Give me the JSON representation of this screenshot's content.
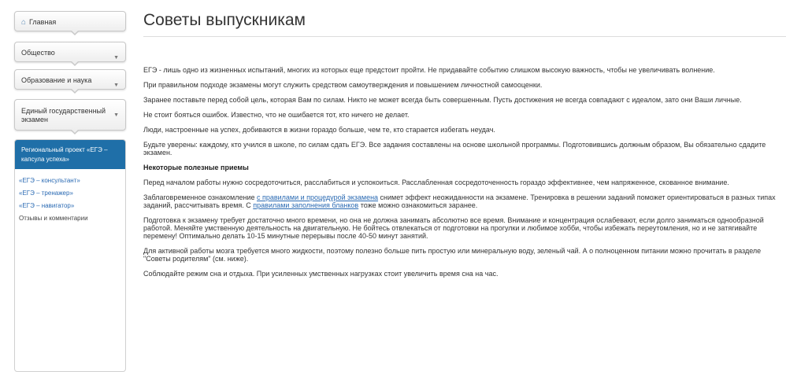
{
  "sidebar": {
    "home": "Главная",
    "items": [
      "Общество",
      "Образование и наука",
      "Единый государственный экзамен"
    ],
    "project": {
      "title": "Региональный проект «ЕГЭ – капсула успеха»",
      "links": [
        "«ЕГЭ – консультант»",
        "«ЕГЭ – тренажер»",
        "«ЕГЭ – навигатор»",
        "Отзывы и комментарии"
      ]
    }
  },
  "main": {
    "title": "Советы выпускникам",
    "p1": "ЕГЭ - лишь одно из жизненных испытаний, многих из которых еще предстоит пройти. Не придавайте событию слишком высокую важность, чтобы не увеличивать волнение.",
    "p2": "При правильном подходе экзамены могут служить средством самоутверждения и повышением личностной самооценки.",
    "p3": "Заранее поставьте перед собой цель, которая Вам по силам. Никто не может всегда быть совершенным. Пусть достижения не всегда совпадают с идеалом, зато они Ваши личные.",
    "p4": "Не стоит бояться ошибок. Известно, что не ошибается тот, кто ничего не делает.",
    "p5": "Люди, настроенные на успех, добиваются в жизни гораздо больше, чем те, кто старается избегать неудач.",
    "p6": "Будьте уверены: каждому, кто учился в школе, по силам сдать ЕГЭ. Все задания составлены на основе школьной программы. Подготовившись должным образом, Вы обязательно сдадите экзамен.",
    "subheading": "Некоторые полезные приемы",
    "p7": "Перед началом работы нужно сосредоточиться, расслабиться и успокоиться. Расслабленная сосредоточенность гораздо эффективнее, чем напряженное, скованное внимание.",
    "p8_a": "Заблаговременное ознакомление ",
    "p8_link1": "с правилами и процедурой экзамена",
    "p8_b": " снимет эффект неожиданности на экзамене. Тренировка в решении заданий поможет ориентироваться в разных типах заданий, рассчитывать время. С ",
    "p8_link2": "правилами заполнения бланков",
    "p8_c": " тоже можно ознакомиться заранее.",
    "p9": "Подготовка к экзамену требует достаточно много времени, но она не должна занимать абсолютно все время. Внимание и концентрация ослабевают, если долго заниматься однообразной работой. Меняйте умственную деятельность на двигательную. Не бойтесь отвлекаться от подготовки на прогулки и любимое хобби, чтобы избежать переутомления, но и не затягивайте перемену! Оптимально делать 10-15 минутные перерывы после 40-50 минут занятий.",
    "p10": "Для активной работы мозга требуется много жидкости, поэтому полезно больше пить простую или минеральную воду, зеленый чай. А о полноценном питании можно прочитать в разделе \"Советы родителям\" (см. ниже).",
    "p11": "Соблюдайте режим сна и отдыха. При усиленных умственных нагрузках стоит увеличить время сна на час."
  }
}
